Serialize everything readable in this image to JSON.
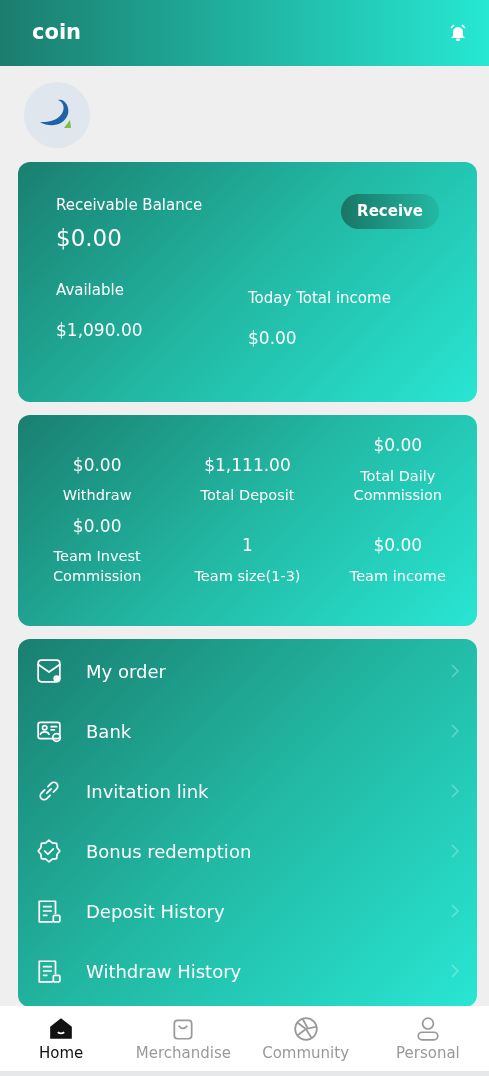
{
  "header": {
    "title": "coin"
  },
  "balance": {
    "receivable_label": "Receivable Balance",
    "receivable_value": "$0.00",
    "receive_button": "Receive",
    "available_label": "Available",
    "available_value": "$1,090.00",
    "today_label": "Today Total income",
    "today_value": "$0.00"
  },
  "stats": [
    {
      "value": "$0.00",
      "label": "Withdraw"
    },
    {
      "value": "$1,111.00",
      "label": "Total Deposit"
    },
    {
      "value": "$0.00",
      "label": "Total Daily Commission"
    },
    {
      "value": "$0.00",
      "label": "Team Invest Commission"
    },
    {
      "value": "1",
      "label": "Team size(1-3)"
    },
    {
      "value": "$0.00",
      "label": "Team income"
    }
  ],
  "menu": [
    {
      "label": "My order",
      "kind": "order"
    },
    {
      "label": "Bank",
      "kind": "bank"
    },
    {
      "label": "Invitation link",
      "kind": "link"
    },
    {
      "label": "Bonus redemption",
      "kind": "bonus"
    },
    {
      "label": "Deposit History",
      "kind": "history"
    },
    {
      "label": "Withdraw History",
      "kind": "history"
    }
  ],
  "tabbar": [
    {
      "label": "Home",
      "kind": "home",
      "selected": true
    },
    {
      "label": "Merchandise",
      "kind": "bag",
      "selected": false
    },
    {
      "label": "Community",
      "kind": "aperture",
      "selected": false
    },
    {
      "label": "Personal",
      "kind": "person",
      "selected": false
    }
  ]
}
